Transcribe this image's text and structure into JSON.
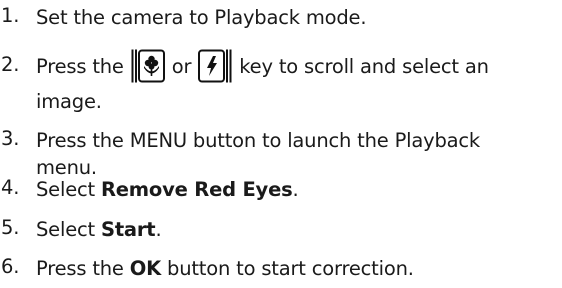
{
  "steps": [
    {
      "num": "1.",
      "text": "Set the camera to Playback mode."
    },
    {
      "num": "2.",
      "before": "Press the ",
      "middle": " or ",
      "after": " key to scroll and select an",
      "line2": "image.",
      "icon_left": "macro-flower-key-icon",
      "icon_right": "flash-key-icon"
    },
    {
      "num": "3.",
      "line1": "Press the MENU button to launch the Playback",
      "line2": "menu."
    },
    {
      "num": "4.",
      "before": "Select ",
      "bold": "Remove Red Eyes",
      "after": "."
    },
    {
      "num": "5.",
      "before": "Select ",
      "bold": "Start",
      "after": "."
    },
    {
      "num": "6.",
      "before": "Press the ",
      "bold": "OK",
      "after": " button to start correction."
    }
  ]
}
